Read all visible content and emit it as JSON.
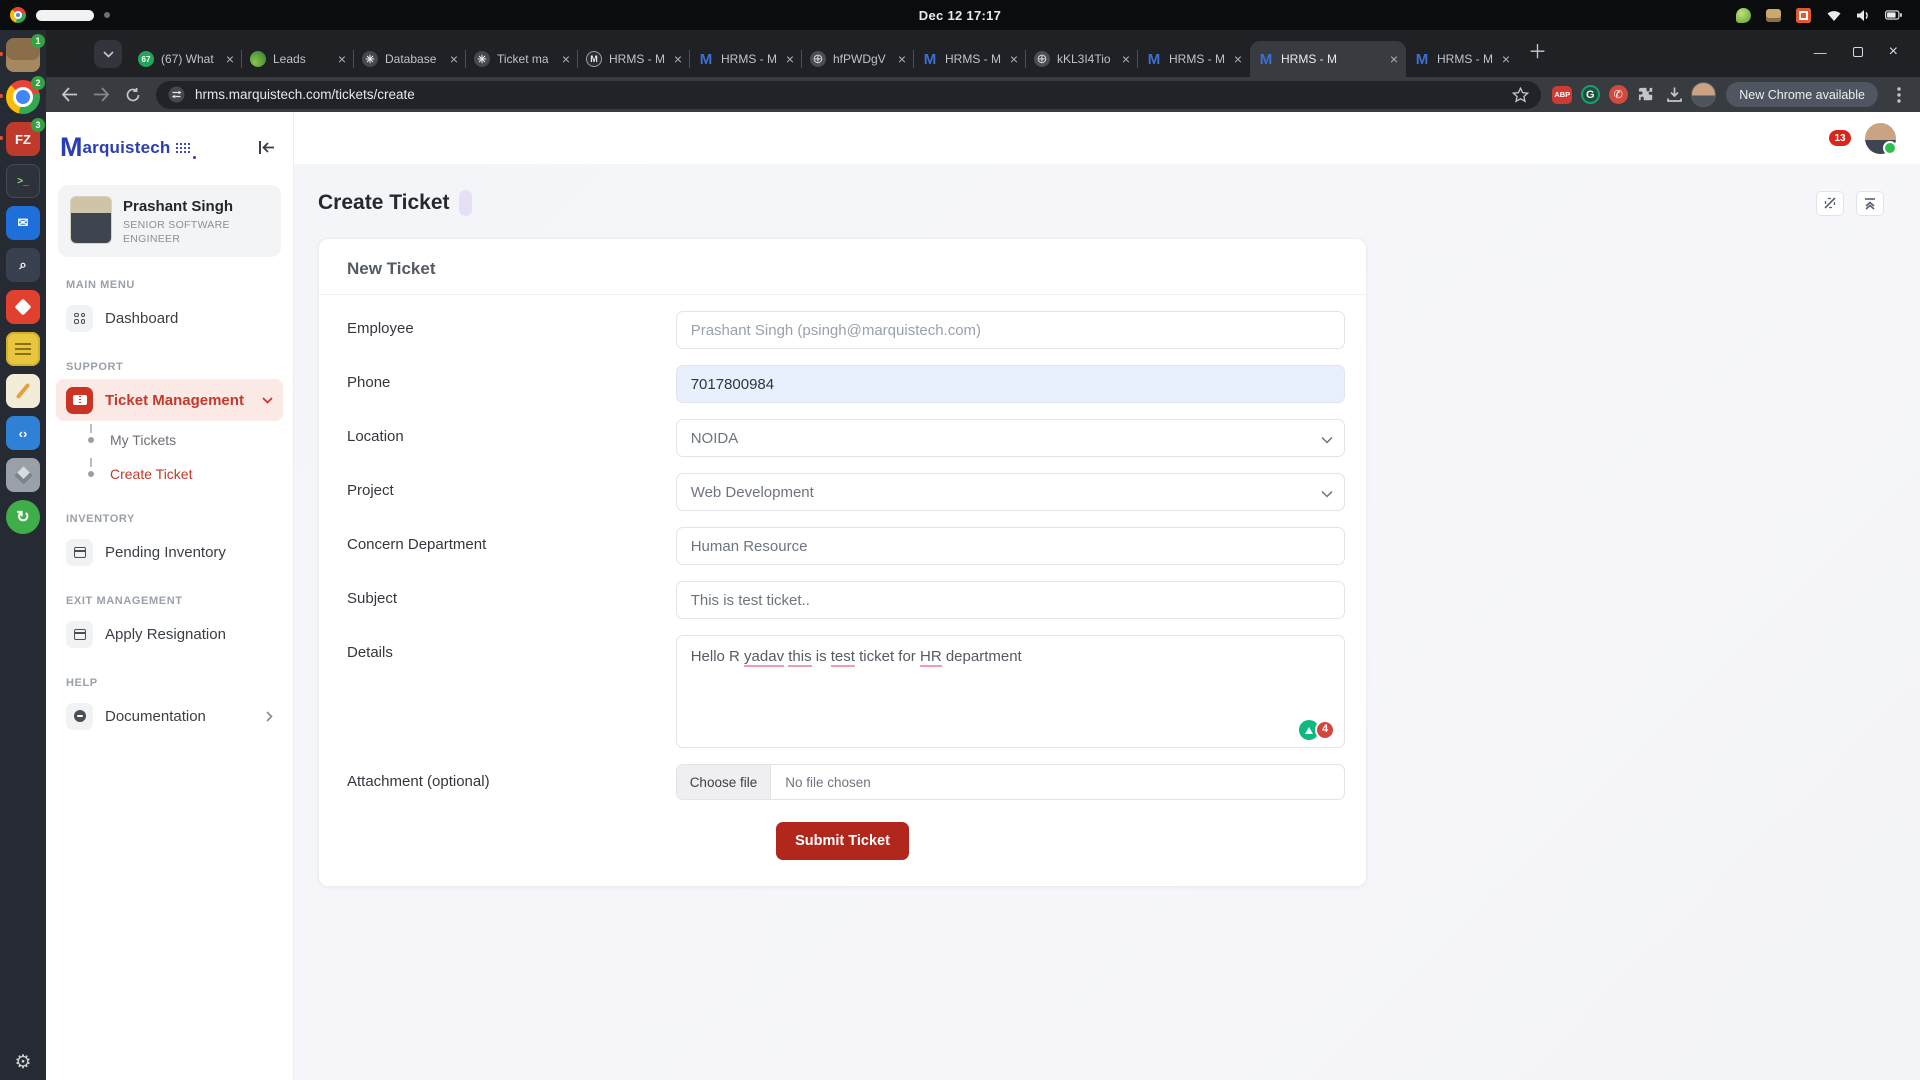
{
  "colors": {
    "accent_red": "#c3392b",
    "logo_blue": "#2b3db5",
    "active_item_bg": "#fbe9e6",
    "autofill_bg": "#e8f0fe",
    "submit_red": "#b1271b",
    "update_chip_bg": "#4f5661"
  },
  "system_bar": {
    "clock": "Dec 12 17:17",
    "tray_icons": [
      "gecko-icon",
      "keyboard-indicator-icon",
      "screen-record-icon",
      "wifi-icon",
      "volume-icon",
      "battery-icon"
    ]
  },
  "dock": {
    "items": [
      {
        "icon": "files-app-icon",
        "kind": "files",
        "badge": "1",
        "running": true
      },
      {
        "icon": "chrome-app-icon",
        "kind": "chrome",
        "badge": "2",
        "running": true
      },
      {
        "icon": "filezilla-app-icon",
        "kind": "filezilla",
        "badge": "3",
        "running": true,
        "glyph": "FZ"
      },
      {
        "icon": "terminal-app-icon",
        "kind": "terminal",
        "badge": ""
      },
      {
        "icon": "mail-app-icon",
        "kind": "mail",
        "badge": "",
        "glyph": "✉"
      },
      {
        "icon": "search-app-icon",
        "kind": "search",
        "badge": "",
        "glyph": "⌕"
      },
      {
        "icon": "tasks-app-icon",
        "kind": "tasks",
        "badge": ""
      },
      {
        "icon": "notes-app-icon",
        "kind": "notes",
        "badge": ""
      },
      {
        "icon": "text-editor-app-icon",
        "kind": "editor",
        "badge": ""
      },
      {
        "icon": "vscode-app-icon",
        "kind": "vscode",
        "badge": "",
        "glyph": "‹›"
      },
      {
        "icon": "cube-app-icon",
        "kind": "cube",
        "badge": ""
      },
      {
        "icon": "updater-app-icon",
        "kind": "updater",
        "badge": ""
      }
    ],
    "settings_icon": "settings-gear-icon"
  },
  "browser": {
    "tabs": [
      {
        "title": "(67) What",
        "icon": "whatsapp-unread",
        "glyph": "67",
        "active": false
      },
      {
        "title": "Leads",
        "icon": "leads",
        "glyph": "",
        "active": false
      },
      {
        "title": "Database",
        "icon": "openai",
        "glyph": "✳",
        "active": false
      },
      {
        "title": "Ticket ma",
        "icon": "openai",
        "glyph": "✳",
        "active": false
      },
      {
        "title": "HRMS - M",
        "icon": "m-circle",
        "glyph": "M",
        "active": false
      },
      {
        "title": "HRMS - M",
        "icon": "m-blue",
        "glyph": "M",
        "active": false
      },
      {
        "title": "hfPWDgV",
        "icon": "globe",
        "glyph": "⊕",
        "active": false
      },
      {
        "title": "HRMS - M",
        "icon": "m-blue",
        "glyph": "M",
        "active": false
      },
      {
        "title": "kKL3I4Tio",
        "icon": "globe",
        "glyph": "⊕",
        "active": false
      },
      {
        "title": "HRMS - M",
        "icon": "m-blue",
        "glyph": "M",
        "active": false
      },
      {
        "title": "HRMS - M",
        "icon": "m-blue",
        "glyph": "M",
        "active": true
      },
      {
        "title": "HRMS - M",
        "icon": "m-blue",
        "glyph": "M",
        "active": false
      }
    ],
    "toolbar": {
      "url": "hrms.marquistech.com/tickets/create",
      "update_chip": "New Chrome available",
      "adblock_label": "ABP",
      "grammarly_label": "G"
    }
  },
  "app": {
    "logo": {
      "first_letter": "M",
      "rest": "arquistech"
    },
    "header": {
      "notification_count": "13"
    },
    "sidebar": {
      "profile": {
        "name": "Prashant Singh",
        "role_line1": "SENIOR SOFTWARE",
        "role_line2": "ENGINEER"
      },
      "sections": {
        "main_menu": {
          "label": "MAIN MENU",
          "dashboard": "Dashboard"
        },
        "support": {
          "label": "SUPPORT",
          "ticket_management": "Ticket Management",
          "my_tickets": "My Tickets",
          "create_ticket": "Create Ticket"
        },
        "inventory": {
          "label": "INVENTORY",
          "pending_inventory": "Pending Inventory"
        },
        "exit_management": {
          "label": "EXIT MANAGEMENT",
          "apply_resignation": "Apply Resignation"
        },
        "help": {
          "label": "HELP",
          "documentation": "Documentation"
        }
      }
    },
    "page": {
      "title": "Create Ticket",
      "card_title": "New Ticket",
      "fields": {
        "employee": {
          "label": "Employee",
          "value": "Prashant Singh (psingh@marquistech.com)"
        },
        "phone": {
          "label": "Phone",
          "value": "7017800984"
        },
        "location": {
          "label": "Location",
          "value": "NOIDA"
        },
        "project": {
          "label": "Project",
          "value": "Web Development"
        },
        "department": {
          "label": "Concern Department",
          "value": "Human Resource"
        },
        "subject": {
          "label": "Subject",
          "value": "This is test ticket.."
        },
        "details": {
          "label": "Details",
          "segments": [
            {
              "t": "Hello R "
            },
            {
              "t": "yadav",
              "u": true
            },
            {
              "t": " "
            },
            {
              "t": "this",
              "u": true
            },
            {
              "t": " is "
            },
            {
              "t": "test",
              "u": true
            },
            {
              "t": " ticket for "
            },
            {
              "t": "HR",
              "u": true
            },
            {
              "t": " department"
            }
          ],
          "suggestion_count": "4"
        },
        "attachment": {
          "label": "Attachment (optional)",
          "button": "Choose file",
          "status": "No file chosen"
        }
      },
      "submit_label": "Submit Ticket"
    }
  }
}
